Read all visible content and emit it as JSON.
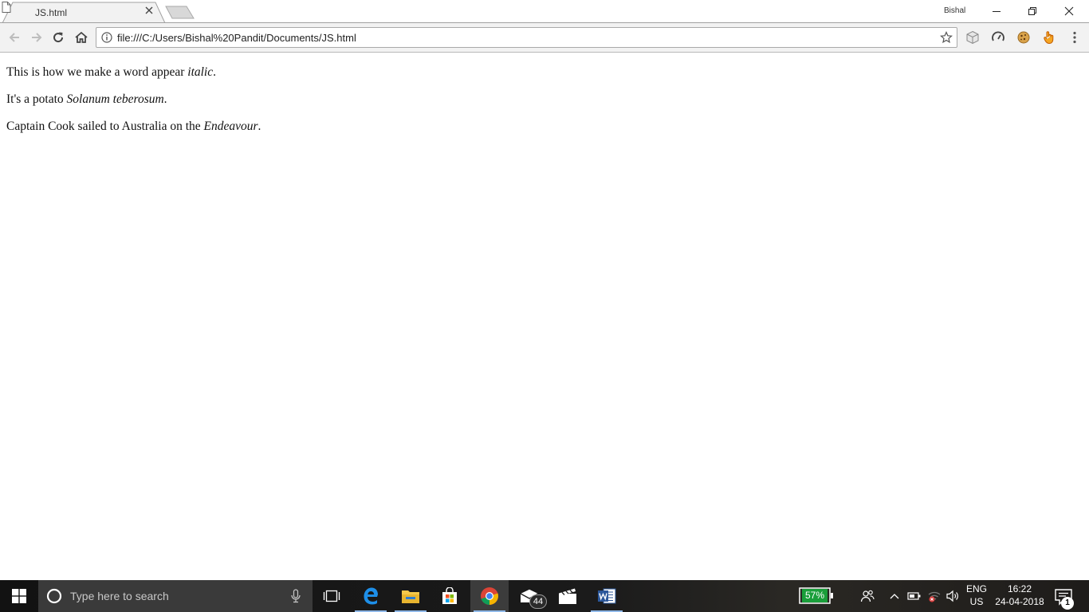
{
  "browser": {
    "tab": {
      "title": "JS.html",
      "favicon": "document-icon"
    },
    "profile_name": "Bishal",
    "window_controls": [
      "minimize-icon",
      "restore-icon",
      "close-icon"
    ],
    "toolbar": {
      "buttons": [
        "back-arrow-icon",
        "forward-arrow-icon",
        "reload-icon",
        "home-icon"
      ],
      "url": "file:///C:/Users/Bishal%20Pandit/Documents/JS.html",
      "extensions": [
        "cube-extension-icon",
        "speedometer-extension-icon",
        "cookie-extension-icon",
        "hand-extension-icon",
        "menu-kebab-icon"
      ]
    }
  },
  "page": {
    "lines": [
      {
        "text": "This is how we make a word appear ",
        "italic": "italic",
        "after": "."
      },
      {
        "text": "It's a potato ",
        "italic": "Solanum teberosum",
        "after": "."
      },
      {
        "text": "Captain Cook sailed to Australia on the ",
        "italic": "Endeavour",
        "after": "."
      }
    ]
  },
  "taskbar": {
    "search_placeholder": "Type here to search",
    "apps": [
      "task-view-icon",
      "edge-icon",
      "file-explorer-icon",
      "store-icon",
      "chrome-icon",
      "mail-icon",
      "movies-icon",
      "word-icon"
    ],
    "mail_badge": "44",
    "battery_percent": "57%",
    "language": {
      "line1": "ENG",
      "line2": "US"
    },
    "clock": {
      "time": "16:22",
      "date": "24-04-2018"
    },
    "notification_count": "1"
  },
  "colors": {
    "accent": "#1a9e3a",
    "taskbar": "#1b1b1b",
    "toolbar": "#f2f2f2"
  }
}
